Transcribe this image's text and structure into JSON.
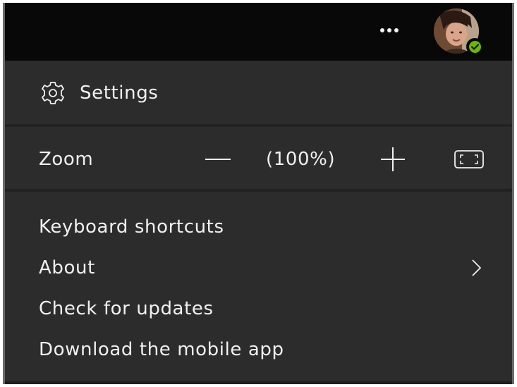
{
  "topbar": {
    "more_icon": "more-horizontal-icon",
    "avatar_icon": "user-avatar",
    "presence_status": "available",
    "presence_color": "#6bb700"
  },
  "menu": {
    "settings": {
      "label": "Settings",
      "icon": "gear-icon"
    },
    "zoom": {
      "label": "Zoom",
      "value": "(100%)",
      "zoom_percent": 100,
      "decrease_icon": "minus-icon",
      "increase_icon": "plus-icon",
      "fullscreen_icon": "fullscreen-icon"
    },
    "items": [
      {
        "label": "Keyboard shortcuts"
      },
      {
        "label": "About",
        "icon": "chevron-right-icon"
      },
      {
        "label": "Check for updates"
      },
      {
        "label": "Download the mobile app"
      }
    ]
  },
  "colors": {
    "menu_background": "#2d2c2c",
    "topbar_background": "#080808",
    "text": "#f0f0f0",
    "separator": "#222222"
  }
}
